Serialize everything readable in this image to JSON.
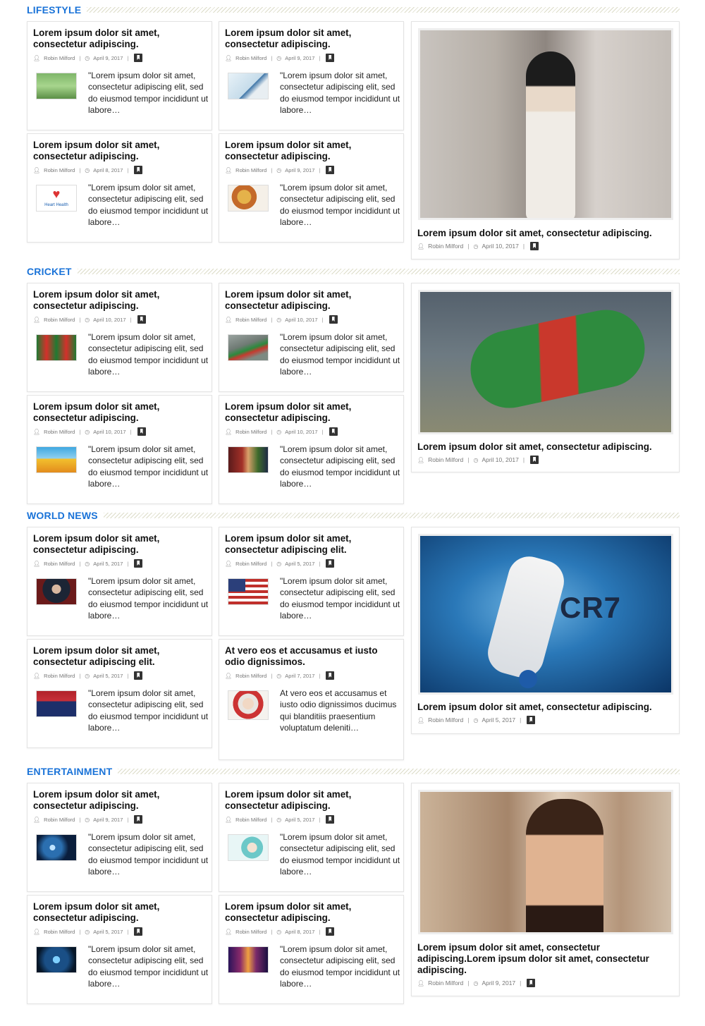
{
  "sections": [
    {
      "title": "LIFESTYLE",
      "cards": [
        {
          "title": "Lorem ipsum dolor sit amet, consectetur adipiscing.",
          "author": "Robin Milford",
          "date": "April 9, 2017",
          "excerpt": "\"Lorem ipsum dolor sit amet, consectetur adipiscing elit, sed do eiusmod tempor incididunt ut labore…",
          "thumb": "couple-cycling"
        },
        {
          "title": "Lorem ipsum dolor sit amet, consectetur adipiscing.",
          "author": "Robin Milford",
          "date": "April 9, 2017",
          "excerpt": "\"Lorem ipsum dolor sit amet, consectetur adipiscing elit, sed do eiusmod tempor incididunt ut labore…",
          "thumb": "woman-window"
        },
        {
          "title": "Lorem ipsum dolor sit amet, consectetur adipiscing.",
          "author": "Robin Milford",
          "date": "April 8, 2017",
          "excerpt": "\"Lorem ipsum dolor sit amet, consectetur adipiscing elit, sed do eiusmod tempor incididunt ut labore…",
          "thumb": "heart-health",
          "thumb_caption": "Heart Health"
        },
        {
          "title": "Lorem ipsum dolor sit amet, consectetur adipiscing.",
          "author": "Robin Milford",
          "date": "April 9, 2017",
          "excerpt": "\"Lorem ipsum dolor sit amet, consectetur adipiscing elit, sed do eiusmod tempor incididunt ut labore…",
          "thumb": "food-platter"
        }
      ],
      "feature": {
        "title": "Lorem ipsum dolor sit amet, consectetur adipiscing.",
        "author": "Robin Milford",
        "date": "April 10, 2017",
        "image": "fashion-model-sunglasses"
      }
    },
    {
      "title": "CRICKET",
      "cards": [
        {
          "title": "Lorem ipsum dolor sit amet, consectetur adipiscing.",
          "author": "Robin Milford",
          "date": "April 10, 2017",
          "excerpt": "\"Lorem ipsum dolor sit amet, consectetur adipiscing elit, sed do eiusmod tempor incididunt ut labore…",
          "thumb": "team-celebration"
        },
        {
          "title": "Lorem ipsum dolor sit amet, consectetur adipiscing.",
          "author": "Robin Milford",
          "date": "April 10, 2017",
          "excerpt": "\"Lorem ipsum dolor sit amet, consectetur adipiscing elit, sed do eiusmod tempor incididunt ut labore…",
          "thumb": "fielder-diving"
        },
        {
          "title": "Lorem ipsum dolor sit amet, consectetur adipiscing.",
          "author": "Robin Milford",
          "date": "April 10, 2017",
          "excerpt": "\"Lorem ipsum dolor sit amet, consectetur adipiscing elit, sed do eiusmod tempor incididunt ut labore…",
          "thumb": "cricket-cartoon"
        },
        {
          "title": "Lorem ipsum dolor sit amet, consectetur adipiscing.",
          "author": "Robin Milford",
          "date": "April 10, 2017",
          "excerpt": "\"Lorem ipsum dolor sit amet, consectetur adipiscing elit, sed do eiusmod tempor incididunt ut labore…",
          "thumb": "batsman"
        }
      ],
      "feature": {
        "title": "Lorem ipsum dolor sit amet, consectetur adipiscing.",
        "author": "Robin Milford",
        "date": "April 10, 2017",
        "image": "cricketer-diving-catch"
      }
    },
    {
      "title": "WORLD NEWS",
      "cards": [
        {
          "title": "Lorem ipsum dolor sit amet, consectetur adipiscing.",
          "author": "Robin Milford",
          "date": "April 5, 2017",
          "excerpt": "\"Lorem ipsum dolor sit amet, consectetur adipiscing elit, sed do eiusmod tempor incididunt ut labore…",
          "thumb": "politician-podium"
        },
        {
          "title": "Lorem ipsum dolor sit amet, consectetur adipiscing elit.",
          "author": "Robin Milford",
          "date": "April 5, 2017",
          "excerpt": "\"Lorem ipsum dolor sit amet, consectetur adipiscing elit, sed do eiusmod tempor incididunt ut labore…",
          "thumb": "president-flag"
        },
        {
          "title": "Lorem ipsum dolor sit amet, consectetur adipiscing elit.",
          "author": "Robin Milford",
          "date": "April 5, 2017",
          "excerpt": "\"Lorem ipsum dolor sit amet, consectetur adipiscing elit, sed do eiusmod tempor incididunt ut labore…",
          "thumb": "rally-speech"
        },
        {
          "title": "At vero eos et accusamus et iusto odio dignissimos.",
          "author": "Robin Milford",
          "date": "April 7, 2017",
          "excerpt": "At vero eos et accusamus et iusto odio dignissimos ducimus qui blanditiis praesentium voluptatum deleniti…",
          "thumb": "queen-portrait"
        }
      ],
      "feature": {
        "title": "Lorem ipsum dolor sit amet, consectetur adipiscing.",
        "author": "Robin Milford",
        "date": "April 5, 2017",
        "image": "footballer-kick",
        "image_text": "CR7"
      }
    },
    {
      "title": "ENTERTAINMENT",
      "cards": [
        {
          "title": "Lorem ipsum dolor sit amet, consectetur adipiscing.",
          "author": "Robin Milford",
          "date": "April 9, 2017",
          "excerpt": "\"Lorem ipsum dolor sit amet, consectetur adipiscing elit, sed do eiusmod tempor incididunt ut labore…",
          "thumb": "film-camera"
        },
        {
          "title": "Lorem ipsum dolor sit amet, consectetur adipiscing.",
          "author": "Robin Milford",
          "date": "April 5, 2017",
          "excerpt": "\"Lorem ipsum dolor sit amet, consectetur adipiscing elit, sed do eiusmod tempor incididunt ut labore…",
          "thumb": "headphones-girl"
        },
        {
          "title": "Lorem ipsum dolor sit amet, consectetur adipiscing.",
          "author": "Robin Milford",
          "date": "April 5, 2017",
          "excerpt": "\"Lorem ipsum dolor sit amet, consectetur adipiscing elit, sed do eiusmod tempor incididunt ut labore…",
          "thumb": "stage-performer"
        },
        {
          "title": "Lorem ipsum dolor sit amet, consectetur adipiscing.",
          "author": "Robin Milford",
          "date": "April 8, 2017",
          "excerpt": "\"Lorem ipsum dolor sit amet, consectetur adipiscing elit, sed do eiusmod tempor incididunt ut labore…",
          "thumb": "concert-lights"
        }
      ],
      "feature": {
        "title": "Lorem ipsum dolor sit amet, consectetur adipiscing.Lorem ipsum dolor sit amet, consectetur adipiscing.",
        "author": "Robin Milford",
        "date": "April 9, 2017",
        "image": "actress-wall"
      }
    }
  ],
  "icons": {
    "author": "user-icon",
    "date": "clock-icon",
    "bookmark": "bookmark-icon"
  },
  "colors": {
    "section_title": "#1a73d8"
  }
}
